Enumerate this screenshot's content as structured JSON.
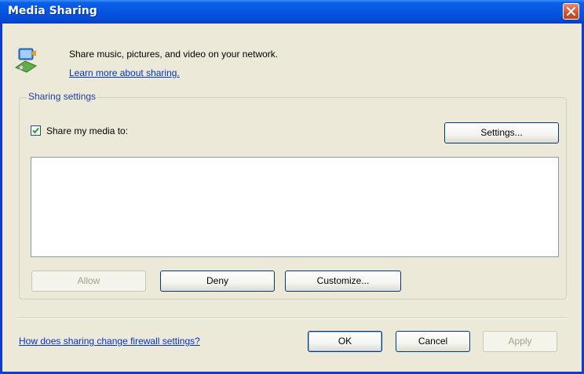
{
  "window": {
    "title": "Media Sharing"
  },
  "header": {
    "description": "Share music, pictures, and video on your network.",
    "learn_more_link": "Learn more about sharing."
  },
  "sharing_settings": {
    "group_label": "Sharing settings",
    "share_checkbox_label": "Share my media to:",
    "share_checked": true,
    "settings_button": "Settings...",
    "device_list": [],
    "allow_button": "Allow",
    "deny_button": "Deny",
    "customize_button": "Customize..."
  },
  "footer": {
    "firewall_link": "How does sharing change firewall settings?",
    "ok_button": "OK",
    "cancel_button": "Cancel",
    "apply_button": "Apply"
  },
  "icons": {
    "header": "network-media-icon",
    "close": "close-icon",
    "checkbox": "checkmark-icon"
  },
  "colors": {
    "title_bar": "#0656e0",
    "window_face": "#ece9d8",
    "link": "#0033cc",
    "close_button": "#d4512c"
  }
}
